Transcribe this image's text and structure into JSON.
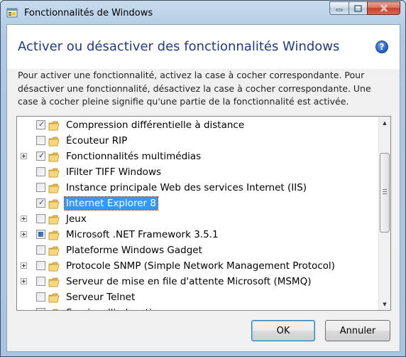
{
  "window": {
    "title": "Fonctionnalités de Windows",
    "controls": [
      "minimize-icon",
      "maximize-icon",
      "close-icon"
    ]
  },
  "header": {
    "heading": "Activer ou désactiver des fonctionnalités Windows",
    "help_icon": "?"
  },
  "description": "Pour activer une fonctionnalité, activez la case à cocher correspondante. Pour désactiver une fonctionnalité, désactivez la case à cocher correspondante. Une case à cocher pleine signifie qu'une partie de la fonctionnalité est activée.",
  "features": [
    {
      "label": "Compression différentielle à distance",
      "state": "checked",
      "expandable": false,
      "selected": false
    },
    {
      "label": "Écouteur RIP",
      "state": "unchecked",
      "expandable": false,
      "selected": false
    },
    {
      "label": "Fonctionnalités multimédias",
      "state": "checked",
      "expandable": true,
      "selected": false
    },
    {
      "label": "IFilter TIFF Windows",
      "state": "unchecked",
      "expandable": false,
      "selected": false
    },
    {
      "label": "Instance principale Web des services Internet (IIS)",
      "state": "unchecked",
      "expandable": false,
      "selected": false
    },
    {
      "label": "Internet Explorer 8",
      "state": "checked",
      "expandable": false,
      "selected": true
    },
    {
      "label": "Jeux",
      "state": "unchecked",
      "expandable": true,
      "selected": false
    },
    {
      "label": "Microsoft .NET Framework 3.5.1",
      "state": "partial",
      "expandable": true,
      "selected": false
    },
    {
      "label": "Plateforme Windows Gadget",
      "state": "unchecked",
      "expandable": false,
      "selected": false
    },
    {
      "label": "Protocole SNMP (Simple Network Management Protocol)",
      "state": "unchecked",
      "expandable": true,
      "selected": false
    },
    {
      "label": "Serveur de mise en file d'attente Microsoft (MSMQ)",
      "state": "unchecked",
      "expandable": true,
      "selected": false
    },
    {
      "label": "Serveur Telnet",
      "state": "unchecked",
      "expandable": false,
      "selected": false
    },
    {
      "label": "Service d'indexation",
      "state": "unchecked",
      "expandable": false,
      "selected": false
    }
  ],
  "buttons": {
    "ok": "OK",
    "cancel": "Annuler"
  },
  "colors": {
    "heading": "#1e3b8a",
    "selection": "#3399ff",
    "close_button": "#c74228"
  }
}
